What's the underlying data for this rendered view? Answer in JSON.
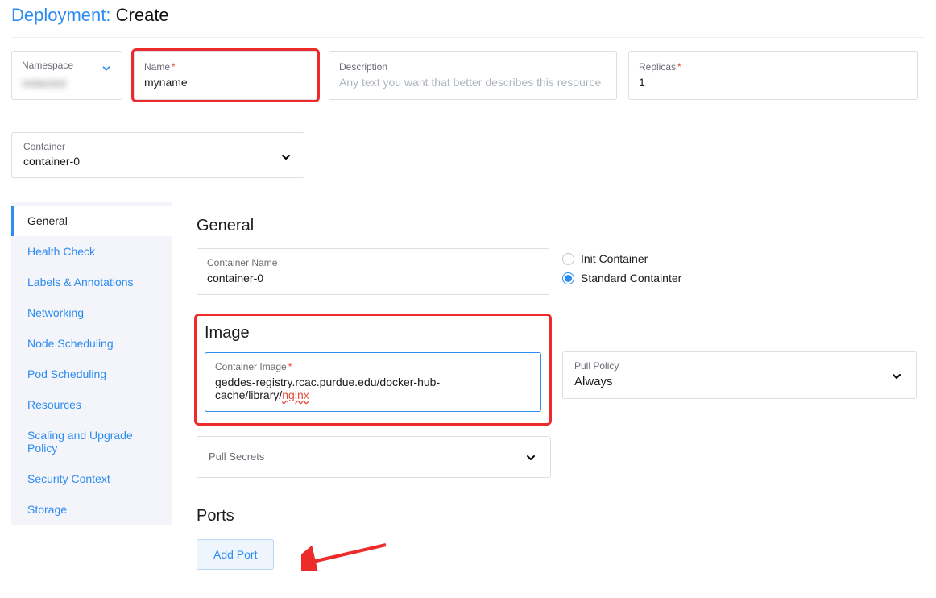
{
  "page": {
    "title_prefix": "Deployment:",
    "title_suffix": " Create"
  },
  "fields": {
    "namespace": {
      "label": "Namespace"
    },
    "name": {
      "label": "Name",
      "value": "myname"
    },
    "description": {
      "label": "Description",
      "placeholder": "Any text you want that better describes this resource"
    },
    "replicas": {
      "label": "Replicas",
      "value": "1"
    }
  },
  "containerSelect": {
    "label": "Container",
    "value": "container-0"
  },
  "sidenav": {
    "items": [
      {
        "label": "General"
      },
      {
        "label": "Health Check"
      },
      {
        "label": "Labels & Annotations"
      },
      {
        "label": "Networking"
      },
      {
        "label": "Node Scheduling"
      },
      {
        "label": "Pod Scheduling"
      },
      {
        "label": "Resources"
      },
      {
        "label": "Scaling and Upgrade Policy"
      },
      {
        "label": "Security Context"
      },
      {
        "label": "Storage"
      }
    ]
  },
  "general": {
    "heading": "General",
    "containerName": {
      "label": "Container Name",
      "value": "container-0"
    },
    "radio": {
      "init": "Init Container",
      "standard": "Standard Containter"
    },
    "imageHeading": "Image",
    "containerImage": {
      "label": "Container Image",
      "value_pre": "geddes-registry.rcac.purdue.edu/docker-hub-cache/library/",
      "value_link": "nginx"
    },
    "pullPolicy": {
      "label": "Pull Policy",
      "value": "Always"
    },
    "pullSecrets": {
      "label": "Pull Secrets"
    },
    "portsHeading": "Ports",
    "addPort": "Add Port"
  }
}
